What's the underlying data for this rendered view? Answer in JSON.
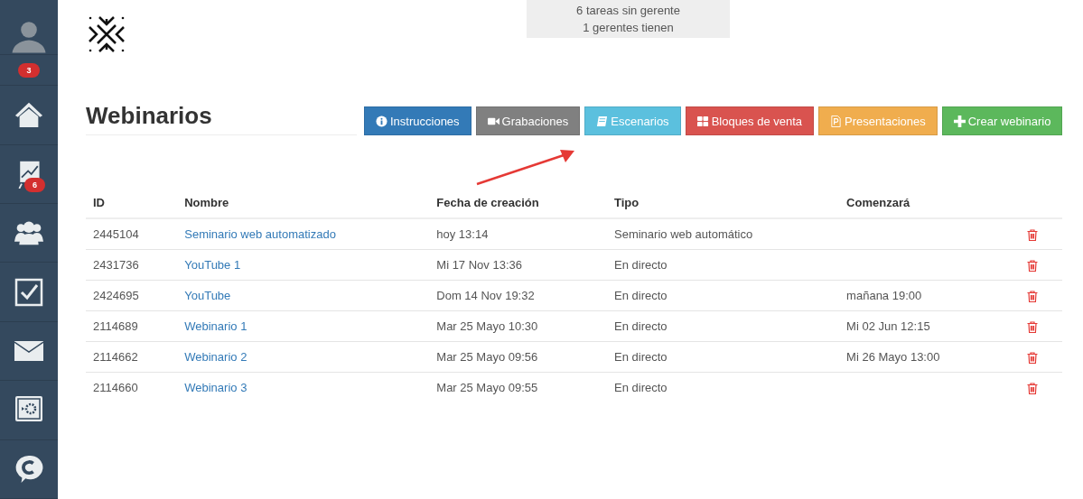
{
  "sidebar": {
    "items": [
      {
        "kind": "avatar"
      },
      {
        "kind": "badge-row",
        "badge": "3"
      },
      {
        "kind": "home"
      },
      {
        "kind": "chart",
        "badge": "6"
      },
      {
        "kind": "people"
      },
      {
        "kind": "tasks"
      },
      {
        "kind": "mail"
      },
      {
        "kind": "safe"
      },
      {
        "kind": "chat"
      }
    ]
  },
  "notice": {
    "lines": [
      "6 tareas sin gerente",
      "1 gerentes tienen"
    ]
  },
  "title": "Webinarios",
  "toolbar": [
    {
      "label": "Instrucciones",
      "kind": "info",
      "color": "#337ab7"
    },
    {
      "label": "Grabaciones",
      "kind": "video",
      "color": "#808080"
    },
    {
      "label": "Escenarios",
      "kind": "book",
      "color": "#5bc0de"
    },
    {
      "label": "Bloques de venta",
      "kind": "grid",
      "color": "#d9534f"
    },
    {
      "label": "Presentaciones",
      "kind": "doc",
      "color": "#f0ad4e"
    },
    {
      "label": "Crear webinario",
      "kind": "plus",
      "color": "#5cb85c"
    }
  ],
  "table": {
    "columns": [
      "ID",
      "Nombre",
      "Fecha de creación",
      "Tipo",
      "Comenzará"
    ],
    "rows": [
      {
        "id": "2445104",
        "name": "Seminario web automatizado",
        "created": "hoy 13:14",
        "type": "Seminario web automático",
        "starts": ""
      },
      {
        "id": "2431736",
        "name": "YouTube 1",
        "created": "Mi 17 Nov 13:36",
        "type": "En directo",
        "starts": ""
      },
      {
        "id": "2424695",
        "name": "YouTube",
        "created": "Dom 14 Nov 19:32",
        "type": "En directo",
        "starts": "mañana 19:00"
      },
      {
        "id": "2114689",
        "name": "Webinario 1",
        "created": "Mar 25 Mayo 10:30",
        "type": "En directo",
        "starts": "Mi 02 Jun 12:15"
      },
      {
        "id": "2114662",
        "name": "Webinario 2",
        "created": "Mar 25 Mayo 09:56",
        "type": "En directo",
        "starts": "Mi 26 Mayo 13:00"
      },
      {
        "id": "2114660",
        "name": "Webinario 3",
        "created": "Mar 25 Mayo 09:55",
        "type": "En directo",
        "starts": ""
      }
    ]
  }
}
